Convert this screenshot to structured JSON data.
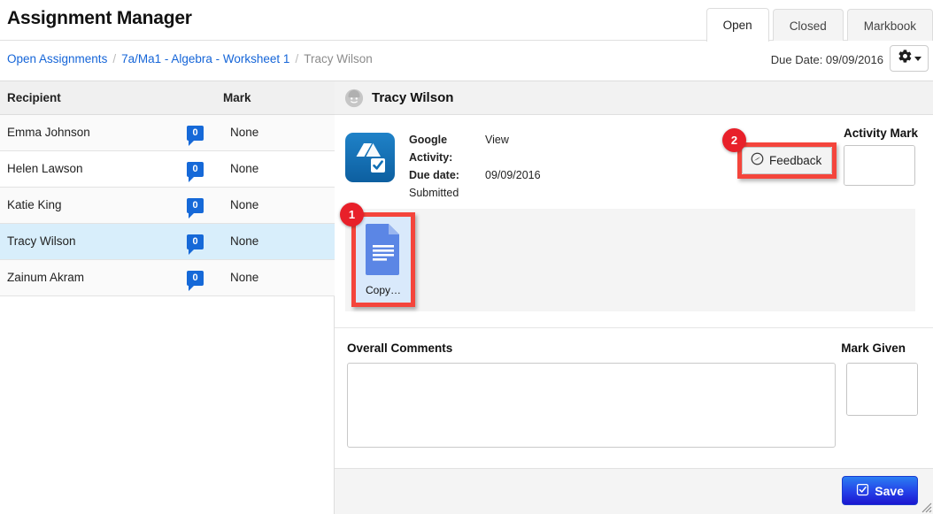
{
  "header": {
    "title": "Assignment Manager",
    "tabs": [
      {
        "label": "Open",
        "active": true
      },
      {
        "label": "Closed",
        "active": false
      },
      {
        "label": "Markbook",
        "active": false
      }
    ]
  },
  "breadcrumb": {
    "items": [
      {
        "label": "Open Assignments",
        "type": "link"
      },
      {
        "label": "7a/Ma1 - Algebra - Worksheet 1",
        "type": "link"
      },
      {
        "label": "Tracy Wilson",
        "type": "current"
      }
    ],
    "separator": "/"
  },
  "toolbar": {
    "due_date": "Due Date: 09/09/2016",
    "gear_icon": "gear-icon",
    "caret_icon": "chevron-down-icon"
  },
  "recipients_table": {
    "columns": [
      "Recipient",
      "",
      "Mark"
    ],
    "rows": [
      {
        "name": "Emma Johnson",
        "count": "0",
        "mark": "None",
        "selected": false
      },
      {
        "name": "Helen Lawson",
        "count": "0",
        "mark": "None",
        "selected": false
      },
      {
        "name": "Katie King",
        "count": "0",
        "mark": "None",
        "selected": false
      },
      {
        "name": "Tracy Wilson",
        "count": "0",
        "mark": "None",
        "selected": true
      },
      {
        "name": "Zainum Akram",
        "count": "0",
        "mark": "None",
        "selected": false
      }
    ]
  },
  "detail": {
    "student_name": "Tracy Wilson",
    "avatar_icon": "avatar-icon",
    "activity_icon": "google-drive-activity-icon",
    "meta": [
      {
        "label": "Google Activity:",
        "value": "View"
      },
      {
        "label": "Due date:",
        "value": "09/09/2016"
      }
    ],
    "status": "Submitted",
    "feedback_button": {
      "label": "Feedback",
      "icon": "feedback-comment-icon",
      "annotation": "2"
    },
    "activity_mark": {
      "label": "Activity Mark",
      "value": "",
      "suffix": "%"
    },
    "files": [
      {
        "name": "Copy…",
        "icon": "google-docs-file-icon",
        "annotation": "1",
        "selected": true
      }
    ],
    "comments": {
      "label": "Overall Comments",
      "value": "",
      "placeholder": ""
    },
    "mark_given": {
      "label": "Mark Given",
      "value": "",
      "suffix": "%"
    },
    "save_button": {
      "label": "Save",
      "icon": "check-square-icon"
    }
  },
  "colors": {
    "link": "#1565d8",
    "badge_blue": "#1669d8",
    "annotation_red": "#e8202a",
    "highlight_red": "#f4453c",
    "row_selected": "#d8eefb",
    "save_blue": "#2440e8"
  }
}
